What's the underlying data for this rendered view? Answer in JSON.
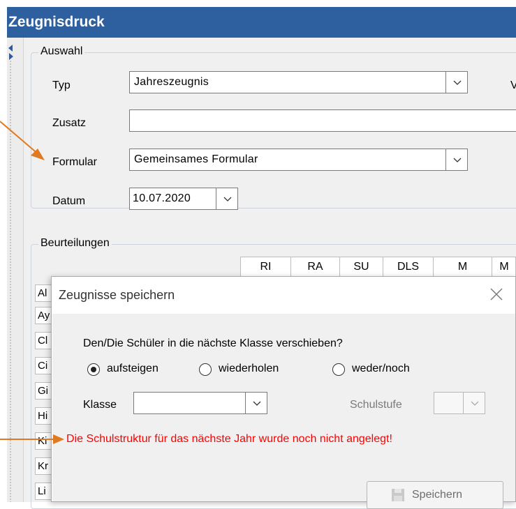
{
  "window": {
    "title": "Zeugnisdruck"
  },
  "auswahl": {
    "group_label": "Auswahl",
    "typ_label": "Typ",
    "typ_value": "Jahreszeugnis",
    "zusatz_label": "Zusatz",
    "zusatz_value": "",
    "formular_label": "Formular",
    "formular_value": "Gemeinsames Formular",
    "datum_label": "Datum",
    "datum_value": "10.07.2020",
    "right_clip_letter": "V"
  },
  "beurteilungen": {
    "group_label": "Beurteilungen",
    "columns": [
      "RI",
      "RA",
      "SU",
      "DLS",
      "M",
      "M"
    ],
    "rows": [
      "Al",
      "Ay",
      "Cl",
      "Ci",
      "Gi",
      "Hi",
      "Ki",
      "Kr",
      "Li"
    ]
  },
  "dialog": {
    "title": "Zeugnisse speichern",
    "question": "Den/Die Schüler in die nächste Klasse verschieben?",
    "options": [
      "aufsteigen",
      "wiederholen",
      "weder/noch"
    ],
    "selected_option": "aufsteigen",
    "klasse_label": "Klasse",
    "klasse_value": "",
    "schulstufe_label": "Schulstufe",
    "schulstufe_value": "",
    "error_text": "Die Schulstruktur für das nächste Jahr wurde noch nicht angelegt!",
    "save_label": "Speichern"
  },
  "colors": {
    "title_bar": "#2e5f9e",
    "annotation_arrow": "#e07a22",
    "error": "#ff0000"
  }
}
